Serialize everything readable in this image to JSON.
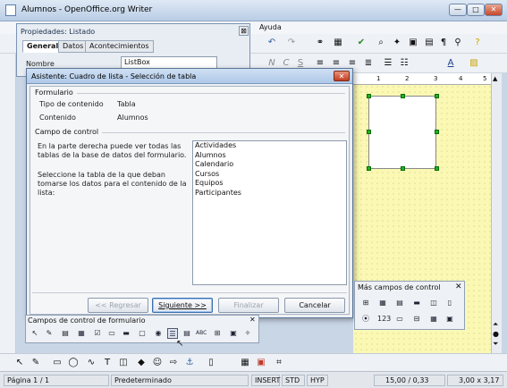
{
  "window": {
    "title": "Alumnos - OpenOffice.org Writer",
    "min": "—",
    "max": "□",
    "close": "✕"
  },
  "menubar": {
    "help": "Ayuda"
  },
  "properties": {
    "title": "Propiedades: Listado",
    "close": "⊠",
    "tabs": [
      "General",
      "Datos",
      "Acontecimientos"
    ],
    "name_label": "Nombre",
    "name_value": "ListBox"
  },
  "wizard": {
    "title": "Asistente: Cuadro de lista - Selección de tabla",
    "close": "✕",
    "form_section": "Formulario",
    "content_type_label": "Tipo de contenido",
    "content_type_value": "Tabla",
    "content_label": "Contenido",
    "content_value": "Alumnos",
    "control_section": "Campo de control",
    "desc1": "En la parte derecha puede ver todas las tablas de la base de datos del formulario.",
    "desc2": "Seleccione la tabla de la que deban tomarse los datos para el contenido de la lista:",
    "tables": [
      "Actividades",
      "Alumnos",
      "Calendario",
      "Cursos",
      "Equipos",
      "Participantes"
    ],
    "buttons": {
      "back": "<< Regresar",
      "next": "Siguiente >>",
      "finish": "Finalizar",
      "cancel": "Cancelar"
    }
  },
  "more_controls": {
    "title": "Más campos de control",
    "close": "✕",
    "icons": [
      "⊞",
      "▦",
      "▤",
      "▬",
      "◫",
      "▯",
      "⦿",
      "123",
      "▭",
      "⊟",
      "▦",
      "▣"
    ]
  },
  "form_controls": {
    "title": "Campos de control de formulario",
    "close": "✕"
  },
  "ruler": {
    "ticks": [
      "1",
      "2",
      "3",
      "4",
      "5"
    ]
  },
  "status": {
    "page": "Página 1 / 1",
    "style": "Predeterminado",
    "insert": "INSERT",
    "std": "STD",
    "hyp": "HYP",
    "position": "15,00 / 0,33",
    "size": "3,00 x 3,17"
  }
}
